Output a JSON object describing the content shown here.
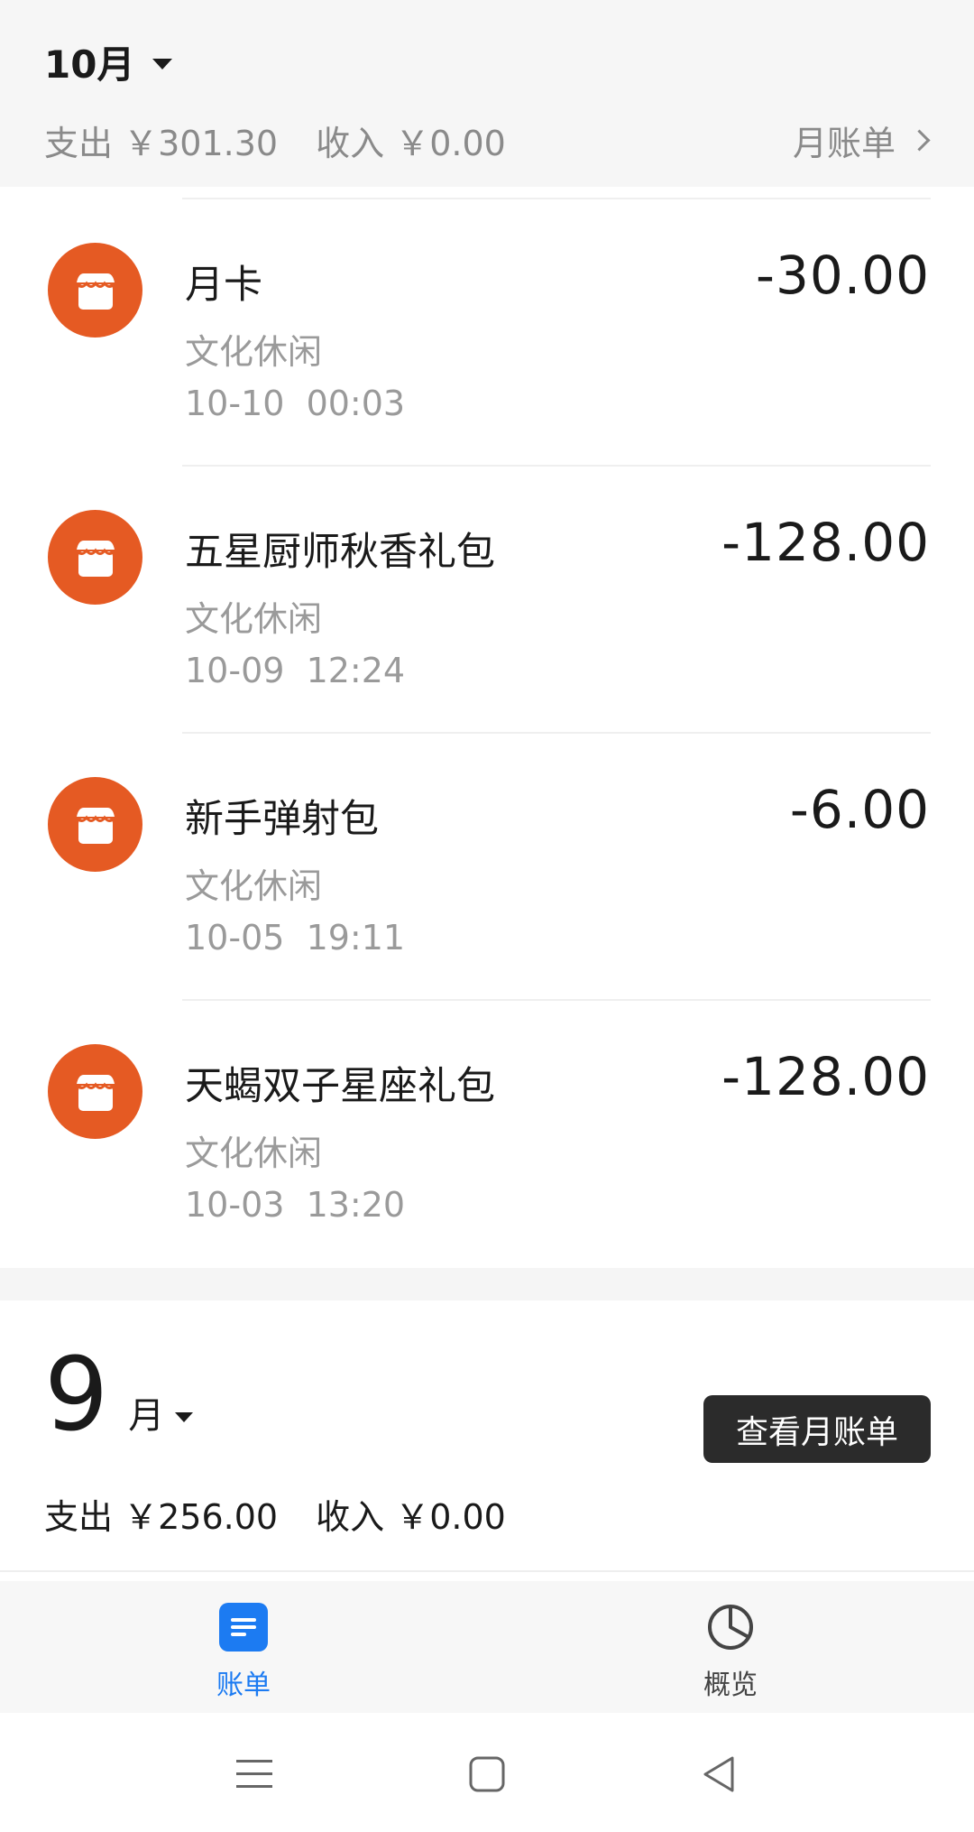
{
  "header": {
    "month": "10月",
    "expense_label": "支出",
    "expense_value": "￥301.30",
    "income_label": "收入",
    "income_value": "￥0.00",
    "monthly_bill_link": "月账单"
  },
  "transactions": [
    {
      "name": "月卡",
      "category": "文化休闲",
      "time": "10-10  00:03",
      "amount": "-30.00",
      "icon": "store-icon"
    },
    {
      "name": "五星厨师秋香礼包",
      "category": "文化休闲",
      "time": "10-09  12:24",
      "amount": "-128.00",
      "icon": "store-icon"
    },
    {
      "name": "新手弹射包",
      "category": "文化休闲",
      "time": "10-05  19:11",
      "amount": "-6.00",
      "icon": "store-icon"
    },
    {
      "name": "天蝎双子星座礼包",
      "category": "文化休闲",
      "time": "10-03  13:20",
      "amount": "-128.00",
      "icon": "store-icon"
    }
  ],
  "september": {
    "month_number": "9",
    "month_unit": "月",
    "view_bill_button": "查看月账单",
    "expense_label": "支出",
    "expense_value": "￥256.00",
    "income_label": "收入",
    "income_value": "￥0.00"
  },
  "tabs": [
    {
      "label": "账单",
      "icon": "bill-icon",
      "active": true
    },
    {
      "label": "概览",
      "icon": "pie-chart-icon",
      "active": false
    }
  ],
  "system_nav": [
    "menu-icon",
    "home-icon",
    "back-icon"
  ],
  "colors": {
    "accent_blue": "#1c7bf2",
    "icon_orange": "#e55a23",
    "text_primary": "#1a1a1a",
    "text_secondary": "#9a9a9a"
  }
}
